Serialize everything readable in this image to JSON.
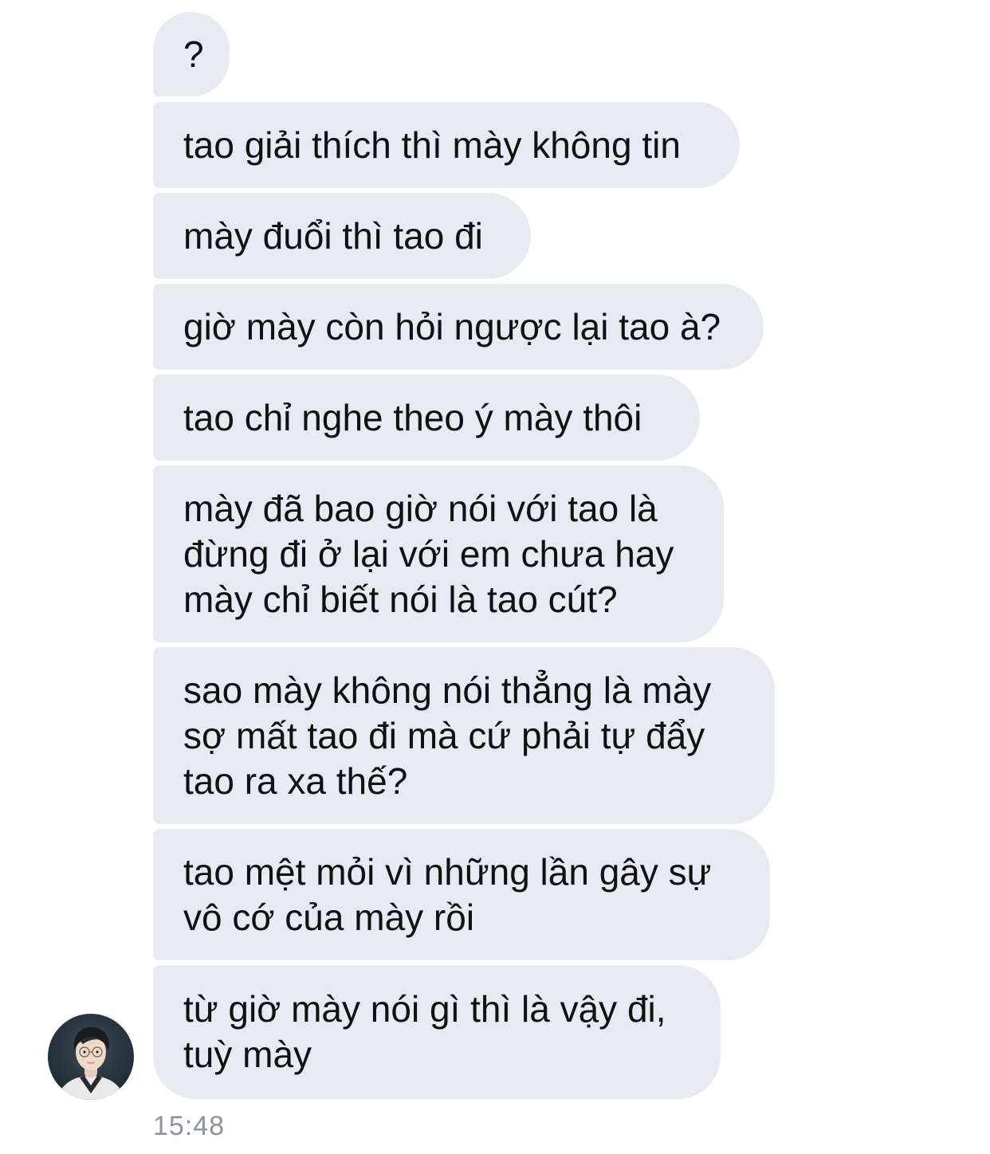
{
  "conversation": {
    "messages": [
      {
        "text": "?"
      },
      {
        "text": "tao giải thích thì mày không tin"
      },
      {
        "text": "mày đuổi thì tao đi"
      },
      {
        "text": "giờ mày còn hỏi ngược lại tao à?"
      },
      {
        "text": "tao chỉ nghe theo ý mày thôi"
      },
      {
        "text": "mày đã bao giờ nói với tao là\nđừng đi ở lại với em chưa hay\nmày chỉ biết nói là tao cút?"
      },
      {
        "text": "sao mày không nói thẳng là mày\nsợ mất tao đi mà cứ phải tự đẩy\ntao ra xa thế?"
      },
      {
        "text": "tao mệt mỏi vì những lần gây sự\nvô cớ của mày rồi"
      },
      {
        "text": "từ giờ mày nói gì thì là vậy đi,\ntuỳ mày"
      }
    ],
    "timestamp": "15:48",
    "avatar_icon": "profile-avatar"
  },
  "colors": {
    "bubble_background": "#e8eaf1",
    "text": "#111111",
    "timestamp": "#8e929b"
  }
}
